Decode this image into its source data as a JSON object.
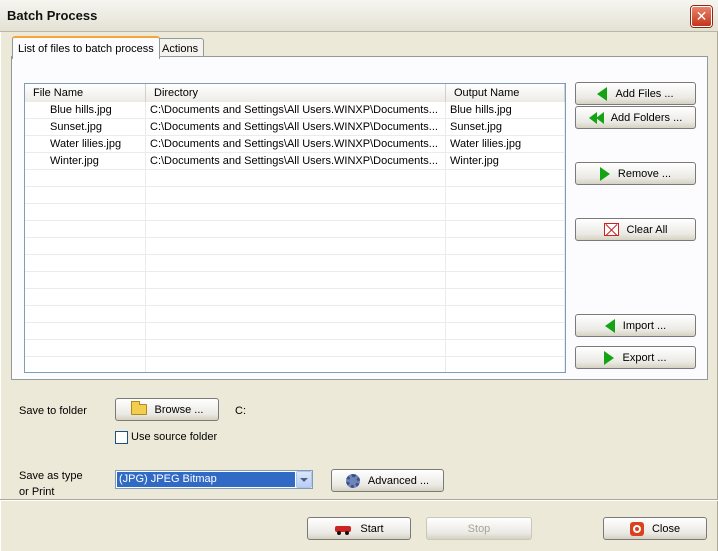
{
  "window": {
    "title": "Batch Process",
    "close_symbol": "✕"
  },
  "tabs": [
    {
      "label": "List of files to batch process",
      "active": true
    },
    {
      "label": "Actions",
      "active": false
    }
  ],
  "file_list": {
    "headers": [
      "File Name",
      "Directory",
      "Output Name"
    ],
    "rows": [
      {
        "file_name": "Blue hills.jpg",
        "directory": "C:\\Documents and Settings\\All Users.WINXP\\Documents...",
        "output_name": "Blue hills.jpg"
      },
      {
        "file_name": "Sunset.jpg",
        "directory": "C:\\Documents and Settings\\All Users.WINXP\\Documents...",
        "output_name": "Sunset.jpg"
      },
      {
        "file_name": "Water lilies.jpg",
        "directory": "C:\\Documents and Settings\\All Users.WINXP\\Documents...",
        "output_name": "Water lilies.jpg"
      },
      {
        "file_name": "Winter.jpg",
        "directory": "C:\\Documents and Settings\\All Users.WINXP\\Documents...",
        "output_name": "Winter.jpg"
      }
    ]
  },
  "side_buttons": {
    "add_files": "Add Files ...",
    "add_folders": "Add Folders ...",
    "remove": "Remove ...",
    "clear_all": "Clear All",
    "import": "Import ...",
    "export": "Export ..."
  },
  "save_folder": {
    "label": "Save to folder",
    "browse": "Browse ...",
    "path": "C:",
    "use_source_label": "Use source folder",
    "use_source_checked": false
  },
  "save_type": {
    "label_line1": "Save as type",
    "label_line2": "or Print",
    "selected": "(JPG) JPEG Bitmap",
    "advanced": "Advanced ..."
  },
  "footer": {
    "start": "Start",
    "stop": "Stop",
    "close": "Close"
  },
  "colors": {
    "arrow_green": "#13a313",
    "window_bg": "#ece9d8",
    "select_highlight": "#316ac5"
  }
}
